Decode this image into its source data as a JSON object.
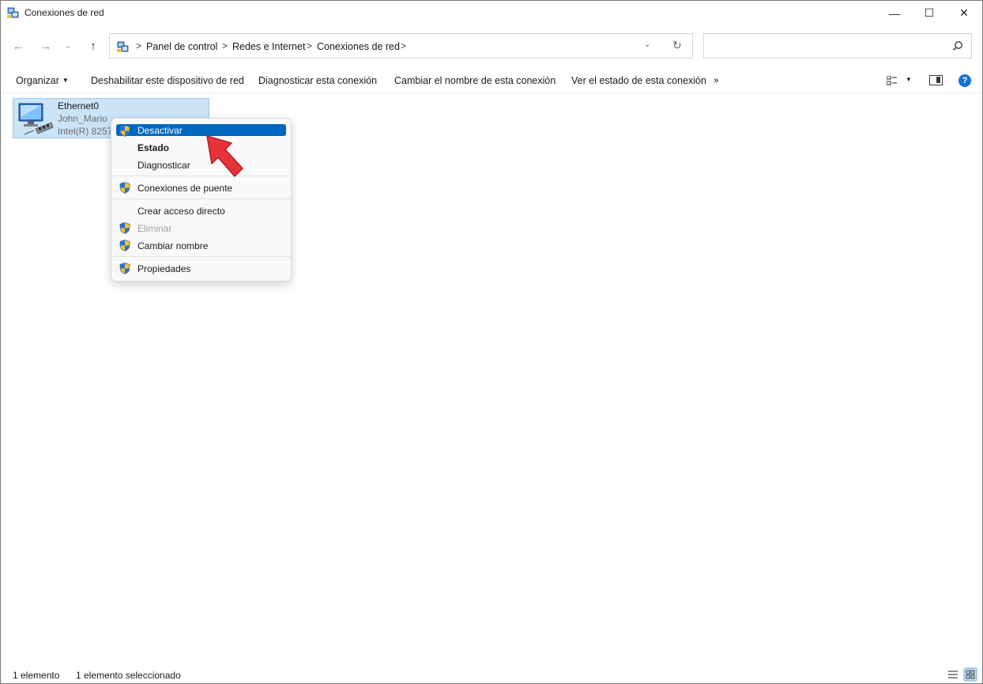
{
  "window": {
    "title": "Conexiones de red",
    "controls": {
      "minimize": "—",
      "maximize": "☐",
      "close": "✕"
    }
  },
  "nav": {
    "back": "←",
    "forward": "→",
    "recent": "⌄",
    "up": "↑"
  },
  "address": {
    "crumbs": [
      "Panel de control",
      "Redes e Internet",
      "Conexiones de red"
    ],
    "separator": ">",
    "dropdown": "⌄",
    "refresh": "↻"
  },
  "search": {
    "placeholder": ""
  },
  "commands": {
    "organize": "Organizar",
    "disable": "Deshabilitar este dispositivo de red",
    "diagnose": "Diagnosticar esta conexión",
    "rename": "Cambiar el nombre de esta conexión",
    "status": "Ver el estado de esta conexión",
    "more": "»"
  },
  "item": {
    "name": "Ethernet0",
    "network": "John_Mario",
    "adapter": "Intel(R) 8257"
  },
  "context_menu": {
    "items": [
      {
        "label": "Desactivar",
        "shield": true,
        "state": "highlighted"
      },
      {
        "label": "Estado",
        "shield": false,
        "state": "default-bold"
      },
      {
        "label": "Diagnosticar",
        "shield": false,
        "state": "normal"
      },
      {
        "label": "Conexiones de puente",
        "shield": true,
        "state": "normal"
      },
      {
        "label": "Crear acceso directo",
        "shield": false,
        "state": "normal"
      },
      {
        "label": "Eliminar",
        "shield": true,
        "state": "disabled"
      },
      {
        "label": "Cambiar nombre",
        "shield": true,
        "state": "normal"
      },
      {
        "label": "Propiedades",
        "shield": true,
        "state": "normal"
      }
    ]
  },
  "statusbar": {
    "count": "1 elemento",
    "selected": "1 elemento seleccionado"
  },
  "colors": {
    "accent": "#0067c0",
    "selection": "#cce4f7",
    "annotation_arrow": "#e8323a",
    "help": "#1272d6"
  },
  "icons": {
    "title": "network-connections-icon",
    "shield": "uac-shield-icon",
    "help": "help-icon",
    "search": "search-icon"
  }
}
